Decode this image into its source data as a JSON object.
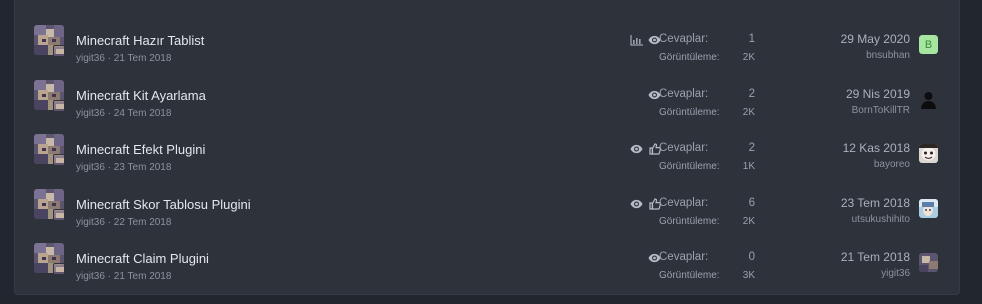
{
  "threads": [
    {
      "title": "Minecraft Hazır Tablist",
      "author": "yigit36",
      "date": "21 Tem 2018",
      "icons": [
        "chart-icon",
        "eye-icon"
      ],
      "replies_label": "Cevaplar:",
      "replies": "1",
      "views_label": "Görüntüleme:",
      "views": "2K",
      "last_date": "29 May 2020",
      "last_user": "bnsubhan",
      "last_avatar": {
        "type": "letter",
        "letter": "B",
        "bg": "#a7e6a0",
        "fg": "#3b8a34"
      }
    },
    {
      "title": "Minecraft Kit Ayarlama",
      "author": "yigit36",
      "date": "24 Tem 2018",
      "icons": [
        "eye-icon"
      ],
      "replies_label": "Cevaplar:",
      "replies": "2",
      "views_label": "Görüntüleme:",
      "views": "2K",
      "last_date": "29 Nis 2019",
      "last_user": "BornToKillTR",
      "last_avatar": {
        "type": "silhouette"
      }
    },
    {
      "title": "Minecraft Efekt Plugini",
      "author": "yigit36",
      "date": "23 Tem 2018",
      "icons": [
        "eye-icon",
        "thumbs-up-icon"
      ],
      "replies_label": "Cevaplar:",
      "replies": "2",
      "views_label": "Görüntüleme:",
      "views": "1K",
      "last_date": "12 Kas 2018",
      "last_user": "bayoreo",
      "last_avatar": {
        "type": "face"
      }
    },
    {
      "title": "Minecraft Skor Tablosu Plugini",
      "author": "yigit36",
      "date": "22 Tem 2018",
      "icons": [
        "eye-icon",
        "thumbs-up-icon"
      ],
      "replies_label": "Cevaplar:",
      "replies": "6",
      "views_label": "Görüntüleme:",
      "views": "2K",
      "last_date": "23 Tem 2018",
      "last_user": "utsukushihito",
      "last_avatar": {
        "type": "anime"
      }
    },
    {
      "title": "Minecraft Claim Plugini",
      "author": "yigit36",
      "date": "21 Tem 2018",
      "icons": [
        "eye-icon"
      ],
      "replies_label": "Cevaplar:",
      "replies": "0",
      "views_label": "Görüntüleme:",
      "views": "3K",
      "last_date": "21 Tem 2018",
      "last_user": "yigit36",
      "last_avatar": {
        "type": "pixel"
      }
    }
  ],
  "meta_separator": " · ",
  "colors": {
    "background": "#22262e",
    "panel": "#2d323b",
    "title": "#e4e8ee",
    "muted": "#8b93a0"
  }
}
